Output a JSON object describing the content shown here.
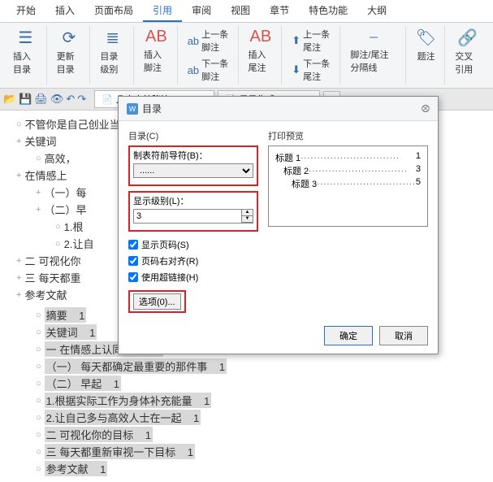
{
  "ribbon": {
    "tabs": [
      "开始",
      "插入",
      "页面布局",
      "引用",
      "审阅",
      "视图",
      "章节",
      "特色功能",
      "大纲"
    ],
    "active": "引用"
  },
  "toolbar": {
    "insert_toc": "插入目录",
    "update_toc": "更新目录",
    "toc_level": "目录级别",
    "insert_footnote": "插入脚注",
    "prev_footnote": "上一条脚注",
    "next_footnote": "下一条脚注",
    "insert_endnote": "插入尾注",
    "prev_endnote": "上一条尾注",
    "next_endnote": "下一条尾注",
    "fn_sep": "脚注/尾注分隔线",
    "caption": "题注",
    "crossref": "交叉引用"
  },
  "qat": {
    "icons": [
      "folder",
      "save",
      "print",
      "preview",
      "undo",
      "redo"
    ]
  },
  "docTabs": {
    "tabs": [
      "几大高效秘诀.docx *",
      "目录生成.docx *"
    ],
    "activeIndex": 1
  },
  "outline": {
    "items": [
      {
        "txt": "不管你是自己创业当老板还是给别人打工，做一个高效的人都是走向职场...",
        "lvl": 0,
        "bullet": "○"
      },
      {
        "txt": "关键词",
        "lvl": 0,
        "bullet": "+"
      },
      {
        "txt": "高效，",
        "lvl": 1,
        "bullet": "○"
      },
      {
        "txt": "在情感上",
        "lvl": 0,
        "bullet": "+"
      },
      {
        "txt": "（一）每",
        "lvl": 1,
        "bullet": "+"
      },
      {
        "txt": "（二）早",
        "lvl": 1,
        "bullet": "+"
      },
      {
        "txt": "1.根",
        "lvl": 2,
        "bullet": "○"
      },
      {
        "txt": "2.让自",
        "lvl": 2,
        "bullet": "○"
      },
      {
        "txt": "可视化你",
        "lvl": 0,
        "bullet": "+",
        "pre": "二"
      },
      {
        "txt": "每天都重",
        "lvl": 0,
        "bullet": "+",
        "pre": "三"
      },
      {
        "txt": "参考文献",
        "lvl": 0,
        "bullet": "+"
      }
    ],
    "body": [
      {
        "txt": "摘要",
        "n": "1"
      },
      {
        "txt": "关键词",
        "n": "1"
      },
      {
        "txt": "一  在情感上认同目标",
        "n": "1"
      },
      {
        "txt": "（一）  每天都确定最重要的那件事",
        "n": "1"
      },
      {
        "txt": "（二）  早起",
        "n": "1"
      },
      {
        "txt": "1.根据实际工作为身体补充能量",
        "n": "1"
      },
      {
        "txt": "2.让自己多与高效人士在一起",
        "n": "1"
      },
      {
        "txt": "二  可视化你的目标",
        "n": "1"
      },
      {
        "txt": "三  每天都重新审视一下目标",
        "n": "1"
      },
      {
        "txt": "参考文献",
        "n": "1"
      }
    ]
  },
  "dialog": {
    "title": "目录",
    "tab_label": "目录(C)",
    "leader_label": "制表符前导符(B)：",
    "leader_value": "......",
    "level_label": "显示级别(L)：",
    "level_value": "3",
    "show_page": "显示页码(S)",
    "right_align": "页码右对齐(R)",
    "use_hyperlink": "使用超链接(H)",
    "options": "选项(0)...",
    "preview_label": "打印预览",
    "preview": [
      {
        "t": "标题 1",
        "n": "1",
        "i": 0
      },
      {
        "t": "标题 2",
        "n": "3",
        "i": 1
      },
      {
        "t": "标题 3",
        "n": "5",
        "i": 2
      }
    ],
    "ok": "确定",
    "cancel": "取消"
  }
}
